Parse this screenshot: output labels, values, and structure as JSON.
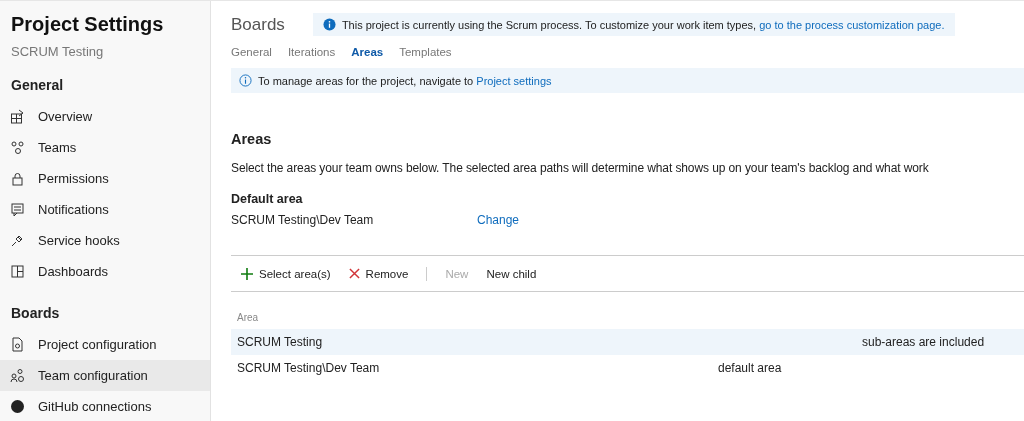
{
  "sidebar": {
    "title": "Project Settings",
    "subtitle": "SCRUM Testing",
    "sections": [
      {
        "heading": "General",
        "items": [
          {
            "label": "Overview",
            "selected": false
          },
          {
            "label": "Teams",
            "selected": false
          },
          {
            "label": "Permissions",
            "selected": false
          },
          {
            "label": "Notifications",
            "selected": false
          },
          {
            "label": "Service hooks",
            "selected": false
          },
          {
            "label": "Dashboards",
            "selected": false
          }
        ]
      },
      {
        "heading": "Boards",
        "items": [
          {
            "label": "Project configuration",
            "selected": false
          },
          {
            "label": "Team configuration",
            "selected": true
          },
          {
            "label": "GitHub connections",
            "selected": false
          }
        ]
      }
    ]
  },
  "header": {
    "title": "Boards",
    "banner": {
      "text": "This project is currently using the Scrum process. To customize your work item types, ",
      "link": "go to the process customization page."
    }
  },
  "tabs": [
    {
      "label": "General",
      "selected": false
    },
    {
      "label": "Iterations",
      "selected": false
    },
    {
      "label": "Areas",
      "selected": true
    },
    {
      "label": "Templates",
      "selected": false
    }
  ],
  "notice": {
    "text": "To manage areas for the project, navigate to ",
    "link": "Project settings"
  },
  "areas": {
    "title": "Areas",
    "description": "Select the areas your team owns below. The selected area paths will determine what shows up on your team's backlog and what work",
    "default_label": "Default area",
    "default_value": "SCRUM Testing\\Dev Team",
    "change": "Change"
  },
  "toolbar": [
    {
      "label": "Select area(s)",
      "kind": "add",
      "disabled": false
    },
    {
      "label": "Remove",
      "kind": "remove",
      "disabled": false
    },
    {
      "label": "New",
      "kind": "plain",
      "disabled": true
    },
    {
      "label": "New child",
      "kind": "plain",
      "disabled": false
    }
  ],
  "table": {
    "columns": [
      "Area"
    ],
    "rows": [
      {
        "area": "SCRUM Testing",
        "column_2": "",
        "column_3": "sub-areas are included",
        "selected": true
      },
      {
        "area": "SCRUM Testing\\Dev Team",
        "column_2": "default area",
        "column_3": "",
        "selected": false
      }
    ]
  }
}
